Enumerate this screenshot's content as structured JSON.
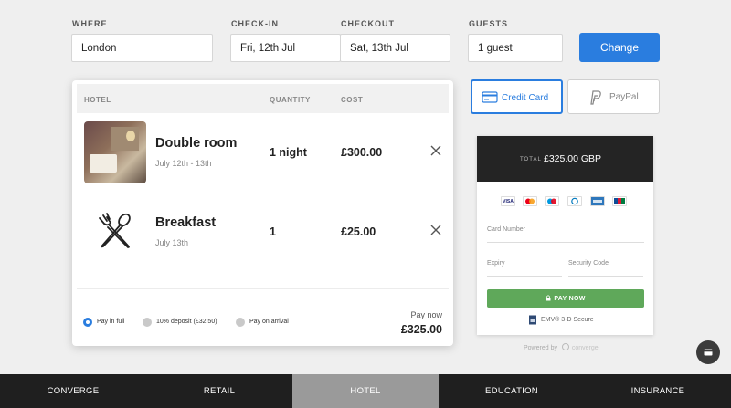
{
  "search": {
    "where_label": "WHERE",
    "where_value": "London",
    "checkin_label": "CHECK-IN",
    "checkin_value": "Fri, 12th Jul",
    "checkout_label": "CHECKOUT",
    "checkout_value": "Sat, 13th Jul",
    "guests_label": "GUESTS",
    "guests_value": "1 guest",
    "change_label": "Change"
  },
  "basket": {
    "headers": {
      "hotel": "HOTEL",
      "quantity": "QUANTITY",
      "cost": "COST"
    },
    "items": [
      {
        "title": "Double room",
        "subtitle": "July 12th - 13th",
        "quantity": "1 night",
        "cost": "£300.00"
      },
      {
        "title": "Breakfast",
        "subtitle": "July 13th",
        "quantity": "1",
        "cost": "£25.00"
      }
    ],
    "payment_options": [
      {
        "label": "Pay in full",
        "selected": true
      },
      {
        "label": "10% deposit (£32.50)",
        "selected": false
      },
      {
        "label": "Pay on arrival",
        "selected": false
      }
    ],
    "pay_now_label": "Pay now",
    "pay_now_total": "£325.00"
  },
  "payment": {
    "tabs": {
      "credit_card": "Credit Card",
      "paypal": "PayPal"
    },
    "total_label": "TOTAL",
    "total_amount": "£325.00 GBP",
    "card_brands": [
      "VISA",
      "mastercard",
      "maestro",
      "diners",
      "amex",
      "JCB"
    ],
    "card_number_placeholder": "Card Number",
    "expiry_placeholder": "Expiry",
    "security_code_placeholder": "Security Code",
    "pay_button": "PAY NOW",
    "secure_text": "EMV® 3-D Secure",
    "powered_by": "Powered by",
    "brand": "converge"
  },
  "nav": [
    "CONVERGE",
    "RETAIL",
    "HOTEL",
    "EDUCATION",
    "INSURANCE"
  ],
  "colors": {
    "accent": "#2a7ddf",
    "pay_button": "#5fa85a",
    "nav_bg": "#1f1f1f",
    "nav_active": "#9a9a9a"
  }
}
